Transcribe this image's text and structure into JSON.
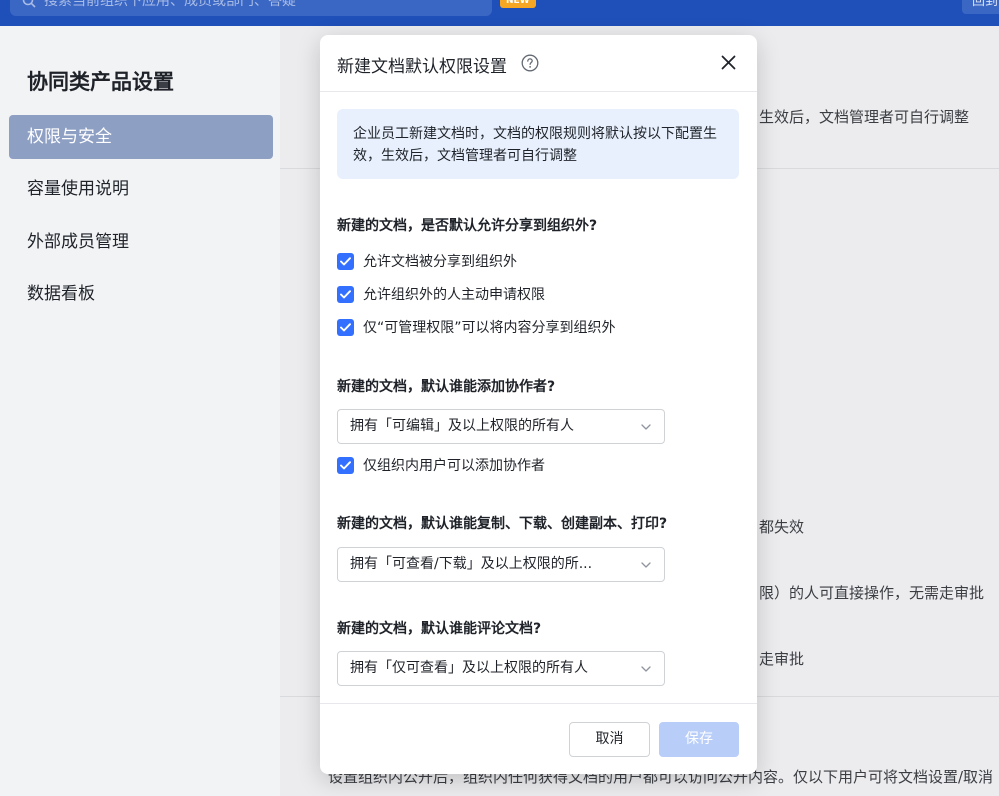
{
  "topbar": {
    "search_placeholder": "搜索当前组织下应用、成员或部门、答疑",
    "new_badge": "NEW",
    "right_button": "回到"
  },
  "sidebar": {
    "title": "协同类产品设置",
    "items": [
      {
        "label": "权限与安全",
        "active": true
      },
      {
        "label": "容量使用说明",
        "active": false
      },
      {
        "label": "外部成员管理",
        "active": false
      },
      {
        "label": "数据看板",
        "active": false
      }
    ]
  },
  "background": {
    "frag1": "生效后，文档管理者可自行调整",
    "frag2": "都失效",
    "frag3": "限）的人可直接操作，无需走审批",
    "frag4": "走审批",
    "frag5": "设置组织内公开后，组织内任何获得文档的用户都可以访问公开内容。仅以下用户可将文档设置/取消"
  },
  "modal": {
    "title": "新建文档默认权限设置",
    "info": "企业员工新建文档时，文档的权限规则将默认按以下配置生效，生效后，文档管理者可自行调整",
    "sections": {
      "share": {
        "title": "新建的文档，是否默认允许分享到组织外?",
        "options": [
          {
            "label": "允许文档被分享到组织外",
            "checked": true
          },
          {
            "label": "允许组织外的人主动申请权限",
            "checked": true
          },
          {
            "label": "仅“可管理权限”可以将内容分享到组织外",
            "checked": true
          }
        ]
      },
      "collaborators": {
        "title": "新建的文档，默认谁能添加协作者?",
        "select_value": "拥有「可编辑」及以上权限的所有人",
        "option": {
          "label": "仅组织内用户可以添加协作者",
          "checked": true
        }
      },
      "copy": {
        "title": "新建的文档，默认谁能复制、下载、创建副本、打印?",
        "select_value": "拥有「可查看/下载」及以上权限的所..."
      },
      "comment": {
        "title": "新建的文档，默认谁能评论文档?",
        "select_value": "拥有「仅可查看」及以上权限的所有人"
      }
    },
    "buttons": {
      "cancel": "取消",
      "save": "保存"
    }
  },
  "colors": {
    "primary": "#3370ff",
    "info_bg": "#e8f0fd",
    "save_disabled": "#b8cdf8",
    "topbar": "#1f4fb8"
  }
}
